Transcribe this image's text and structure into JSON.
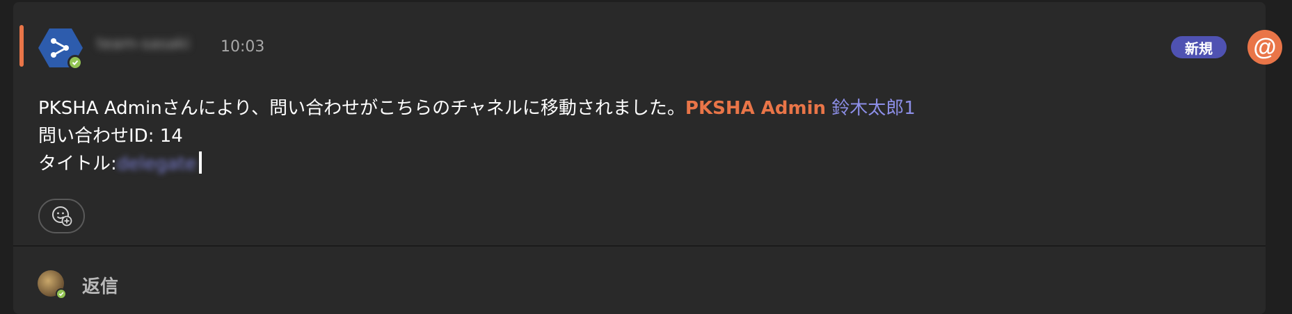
{
  "message": {
    "sender": "team-sasaki",
    "time": "10:03",
    "badge": "新規",
    "line1_text": "PKSHA Adminさんにより、問い合わせがこちらのチャネルに移動されました。",
    "line1_mention": "PKSHA Admin",
    "line1_user": "鈴木太郎1",
    "line2": "問い合わせID: 14",
    "line3_label": "タイトル:",
    "line3_value": "delegate"
  },
  "reply": {
    "label": "返信"
  },
  "colors": {
    "accent": "#e97548",
    "badge": "#4f52b2",
    "mention_user": "#8d8fe8",
    "presence": "#92c353"
  },
  "icons": {
    "bot_avatar": "pksha-bot-hexagon-icon",
    "mention": "at-sign-icon",
    "reaction": "add-reaction-icon",
    "presence": "available-check-icon"
  }
}
